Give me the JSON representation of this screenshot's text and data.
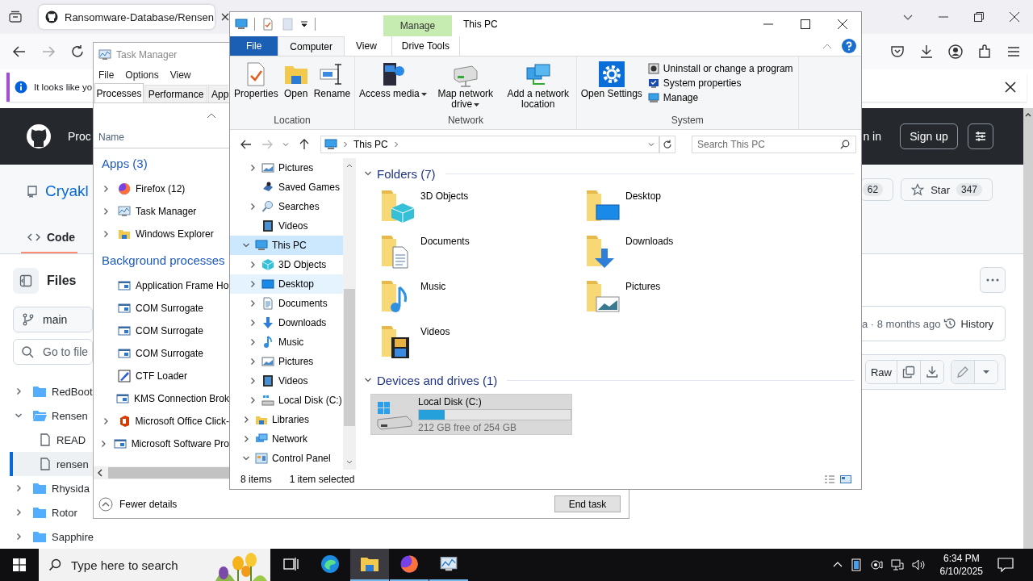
{
  "browser": {
    "tab": {
      "title": "Ransomware-Database/Rensen",
      "selected": true
    },
    "notification": "It looks like yo",
    "header": {
      "brand": "Proc",
      "sign_in": "n in",
      "sign_up": "Sign up"
    },
    "repo": {
      "name": "Cryakl",
      "forks_count": "62",
      "star_label": "Star",
      "star_count": "347"
    },
    "code_tab": {
      "label": "Code",
      "selected": true
    },
    "files_title": "Files",
    "branch": "main",
    "file_search": {
      "placeholder": "Go to file"
    },
    "file_tree": [
      {
        "name": "RedBoot",
        "kind": "folder",
        "expanded": false,
        "selected": false
      },
      {
        "name": "Rensen",
        "kind": "folder",
        "expanded": true,
        "selected": false,
        "children": [
          {
            "name": "READ",
            "kind": "file",
            "selected": false
          },
          {
            "name": "rensen",
            "kind": "file",
            "selected": true
          }
        ]
      },
      {
        "name": "Rhysida",
        "kind": "folder",
        "expanded": false,
        "selected": false
      },
      {
        "name": "Rotor",
        "kind": "folder",
        "expanded": false,
        "selected": false
      },
      {
        "name": "Sapphire",
        "kind": "folder",
        "expanded": false,
        "selected": false
      }
    ],
    "commit_info": "a · 8 months ago",
    "history": "History",
    "raw": "Raw"
  },
  "task_manager": {
    "title": "Task Manager",
    "menu": [
      "File",
      "Options",
      "View"
    ],
    "tabs": [
      {
        "label": "Processes",
        "selected": true
      },
      {
        "label": "Performance",
        "selected": false
      },
      {
        "label": "App",
        "selected": false
      }
    ],
    "column": "Name",
    "groups": [
      {
        "title": "Apps (3)",
        "items": [
          {
            "name": "Firefox (12)",
            "kind": "browser",
            "expandable": true
          },
          {
            "name": "Task Manager",
            "kind": "chart-window",
            "expandable": true
          },
          {
            "name": "Windows Explorer",
            "kind": "folder",
            "expandable": true
          }
        ]
      },
      {
        "title": "Background processes",
        "items": [
          {
            "name": "Application Frame Ho",
            "kind": "window",
            "expandable": false
          },
          {
            "name": "COM Surrogate",
            "kind": "window",
            "expandable": false
          },
          {
            "name": "COM Surrogate",
            "kind": "window",
            "expandable": false
          },
          {
            "name": "COM Surrogate",
            "kind": "window",
            "expandable": false
          },
          {
            "name": "CTF Loader",
            "kind": "pencil",
            "expandable": false
          },
          {
            "name": "KMS Connection Brok",
            "kind": "window",
            "expandable": false
          },
          {
            "name": "Microsoft Office Click-",
            "kind": "hexagon-logo",
            "expandable": true
          },
          {
            "name": "Microsoft Software Pro",
            "kind": "window",
            "expandable": true
          }
        ]
      }
    ],
    "fewer_details": "Fewer details",
    "end_task": "End task"
  },
  "explorer": {
    "context_tab": "Manage",
    "title": "This PC",
    "tabs": [
      {
        "label": "File",
        "kind": "file",
        "selected": false
      },
      {
        "label": "Computer",
        "kind": "tab",
        "selected": true
      },
      {
        "label": "View",
        "kind": "tab",
        "selected": false
      },
      {
        "label": "Drive Tools",
        "kind": "tab",
        "selected": false
      }
    ],
    "ribbon_groups": [
      {
        "label": "Location",
        "buttons": [
          {
            "label": "Properties",
            "kind": "checklist"
          },
          {
            "label": "Open",
            "kind": "folder"
          },
          {
            "label": "Rename",
            "kind": "text-cursor"
          }
        ]
      },
      {
        "label": "Network",
        "buttons": [
          {
            "label": "Access media",
            "kind": "media-tower",
            "dropdown": true
          },
          {
            "label": "Map network drive",
            "kind": "drive",
            "dropdown": true
          },
          {
            "label": "Add a network location",
            "kind": "monitors",
            "dropdown": false
          }
        ]
      },
      {
        "label": "System",
        "buttons": [
          {
            "label": "Open Settings",
            "kind": "gear"
          }
        ],
        "small_buttons": [
          {
            "label": "Uninstall or change a program",
            "kind": "disc-box"
          },
          {
            "label": "System properties",
            "kind": "check-monitor"
          },
          {
            "label": "Manage",
            "kind": "computer"
          }
        ]
      }
    ],
    "address": "This PC",
    "search": {
      "placeholder": "Search This PC"
    },
    "nav_pane": {
      "partial_items": [
        {
          "label": "Pictures",
          "kind": "picture",
          "expandable": true,
          "expanded": false,
          "selected": false,
          "hovered": false
        },
        {
          "label": "Saved Games",
          "kind": "joystick",
          "expandable": false,
          "selected": false,
          "hovered": false
        },
        {
          "label": "Searches",
          "kind": "magnifier",
          "expandable": true,
          "expanded": false,
          "selected": false,
          "hovered": false
        },
        {
          "label": "Videos",
          "kind": "film",
          "expandable": false,
          "selected": false,
          "hovered": false
        }
      ],
      "items": [
        {
          "label": "This PC",
          "kind": "monitor",
          "expandable": true,
          "expanded": true,
          "selected": true,
          "hovered": false,
          "children": [
            {
              "label": "3D Objects",
              "kind": "cube",
              "expandable": true,
              "expanded": false,
              "selected": false,
              "hovered": false
            },
            {
              "label": "Desktop",
              "kind": "screen",
              "expandable": true,
              "expanded": false,
              "selected": false,
              "hovered": true
            },
            {
              "label": "Documents",
              "kind": "document",
              "expandable": true,
              "expanded": false,
              "selected": false,
              "hovered": false
            },
            {
              "label": "Downloads",
              "kind": "down-arrow",
              "expandable": true,
              "expanded": false,
              "selected": false,
              "hovered": false
            },
            {
              "label": "Music",
              "kind": "music-note",
              "expandable": true,
              "expanded": false,
              "selected": false,
              "hovered": false
            },
            {
              "label": "Pictures",
              "kind": "picture",
              "expandable": true,
              "expanded": false,
              "selected": false,
              "hovered": false
            },
            {
              "label": "Videos",
              "kind": "film",
              "expandable": true,
              "expanded": false,
              "selected": false,
              "hovered": false
            },
            {
              "label": "Local Disk (C:)",
              "kind": "drive",
              "expandable": true,
              "expanded": false,
              "selected": false,
              "hovered": false
            }
          ]
        },
        {
          "label": "Libraries",
          "kind": "library",
          "expandable": true,
          "expanded": false,
          "selected": false,
          "hovered": false
        },
        {
          "label": "Network",
          "kind": "network",
          "expandable": true,
          "expanded": false,
          "selected": false,
          "hovered": false
        },
        {
          "label": "Control Panel",
          "kind": "control-panel",
          "expandable": true,
          "expanded": true,
          "selected": false,
          "hovered": false
        }
      ]
    },
    "folders_header": "Folders (7)",
    "folders": [
      {
        "name": "3D Objects",
        "kind": "cube"
      },
      {
        "name": "Desktop",
        "kind": "screen"
      },
      {
        "name": "Documents",
        "kind": "document"
      },
      {
        "name": "Downloads",
        "kind": "down-arrow"
      },
      {
        "name": "Music",
        "kind": "music-note"
      },
      {
        "name": "Pictures",
        "kind": "picture"
      },
      {
        "name": "Videos",
        "kind": "film"
      }
    ],
    "devices_header": "Devices and drives (1)",
    "drives": [
      {
        "name": "Local Disk (C:)",
        "level": 0.17,
        "free": "212 GB free of 254 GB",
        "selected": true
      }
    ],
    "status": {
      "count": "8 items",
      "selection": "1 item selected"
    }
  },
  "taskbar": {
    "search": {
      "placeholder": "Type here to search"
    },
    "apps": [
      {
        "kind": "task-view",
        "selected": false,
        "running": false
      },
      {
        "kind": "wave-logo",
        "selected": false,
        "running": false
      },
      {
        "kind": "folder",
        "selected": true,
        "running": true
      },
      {
        "kind": "fox-globe",
        "selected": false,
        "running": true
      },
      {
        "kind": "chart-window",
        "selected": false,
        "running": true
      }
    ],
    "time": "6:34 PM",
    "date": "6/10/2025"
  }
}
